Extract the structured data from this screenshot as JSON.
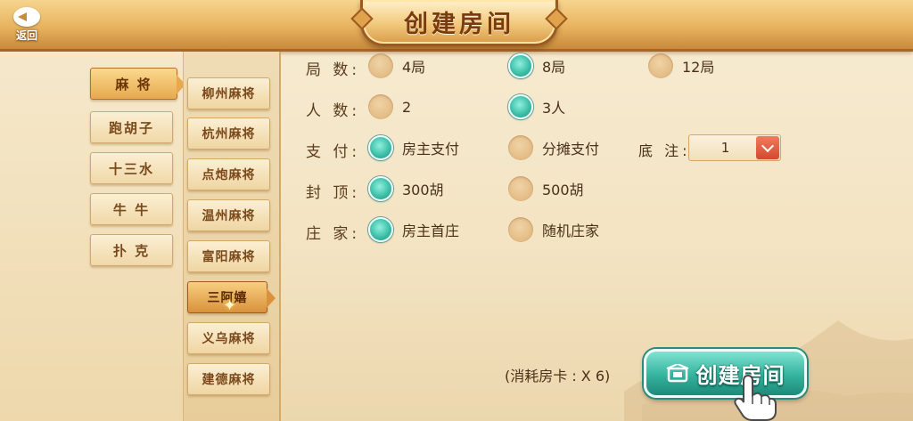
{
  "header": {
    "back_label": "返回",
    "title": "创建房间"
  },
  "categories": [
    {
      "label": "麻 将",
      "active": true
    },
    {
      "label": "跑胡子",
      "active": false
    },
    {
      "label": "十三水",
      "active": false
    },
    {
      "label": "牛 牛",
      "active": false
    },
    {
      "label": "扑 克",
      "active": false
    }
  ],
  "sub_games": [
    {
      "label": "柳州麻将",
      "active": false
    },
    {
      "label": "杭州麻将",
      "active": false
    },
    {
      "label": "点炮麻将",
      "active": false
    },
    {
      "label": "温州麻将",
      "active": false
    },
    {
      "label": "富阳麻将",
      "active": false
    },
    {
      "label": "三阿嬉",
      "active": true
    },
    {
      "label": "义乌麻将",
      "active": false
    },
    {
      "label": "建德麻将",
      "active": false
    }
  ],
  "options": {
    "rounds": {
      "label": "局 数:",
      "choices": [
        "4局",
        "8局",
        "12局"
      ],
      "selected": "8局"
    },
    "players": {
      "label": "人 数:",
      "choices": [
        "2",
        "3人"
      ],
      "selected": "3人"
    },
    "payment": {
      "label": "支 付:",
      "choices": [
        "房主支付",
        "分摊支付"
      ],
      "selected": "房主支付"
    },
    "cap": {
      "label": "封 顶:",
      "choices": [
        "300胡",
        "500胡"
      ],
      "selected": "300胡"
    },
    "dealer": {
      "label": "庄 家:",
      "choices": [
        "房主首庄",
        "随机庄家"
      ],
      "selected": "房主首庄"
    },
    "base_bet": {
      "label": "底 注:",
      "value": "1"
    }
  },
  "footer": {
    "cost_text": "(消耗房卡 : X 6)",
    "create_label": "创建房间"
  },
  "colors": {
    "accent_teal": "#34b39d",
    "header_gold": "#e8b35f",
    "dropdown_red": "#d24a2e"
  }
}
